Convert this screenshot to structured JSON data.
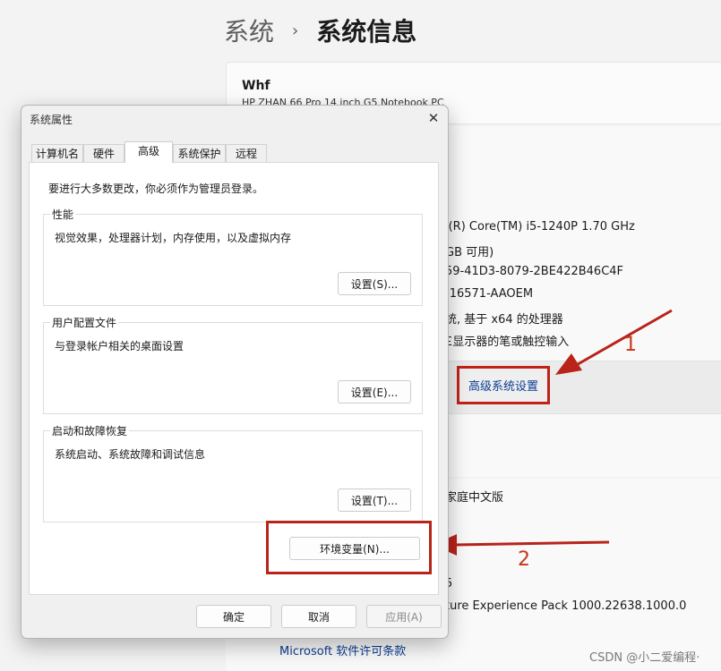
{
  "settings": {
    "breadcrumb": {
      "parent": "系统",
      "separator": "›",
      "current": "系统信息"
    },
    "device": {
      "name": "Whf",
      "model": "HP ZHAN 66 Pro 14 inch G5 Notebook PC"
    },
    "specs": {
      "processor": "l(R) Core(TM) i5-1240P   1.70 GHz",
      "ram": "GB 可用)",
      "device_id": "59-41D3-8079-2BE422B46C4F",
      "product_id": "-16571-AAOEM",
      "system_type": "统, 基于 x64 的处理器",
      "pen_touch": "£显示器的笔或触控输入"
    },
    "advanced_link": "高级系统设置",
    "edition": "家庭中文版",
    "version_fragment": "5",
    "experience": "ture Experience Pack 1000.22638.1000.0",
    "license_link": "Microsoft 软件许可条款"
  },
  "dialog": {
    "title": "系统属性",
    "tabs": [
      "计算机名",
      "硬件",
      "高级",
      "系统保护",
      "远程"
    ],
    "active_tab": "高级",
    "admin_note": "要进行大多数更改，你必须作为管理员登录。",
    "groups": {
      "performance": {
        "title": "性能",
        "desc": "视觉效果，处理器计划，内存使用，以及虚拟内存",
        "button": "设置(S)..."
      },
      "profiles": {
        "title": "用户配置文件",
        "desc": "与登录帐户相关的桌面设置",
        "button": "设置(E)..."
      },
      "startup": {
        "title": "启动和故障恢复",
        "desc": "系统启动、系统故障和调试信息",
        "button": "设置(T)..."
      }
    },
    "env_button": "环境变量(N)...",
    "ok": "确定",
    "cancel": "取消",
    "apply": "应用(A)"
  },
  "annotations": {
    "one": "1",
    "two": "2",
    "color": "#c0211a"
  },
  "watermark": "CSDN @小二爱编程·"
}
